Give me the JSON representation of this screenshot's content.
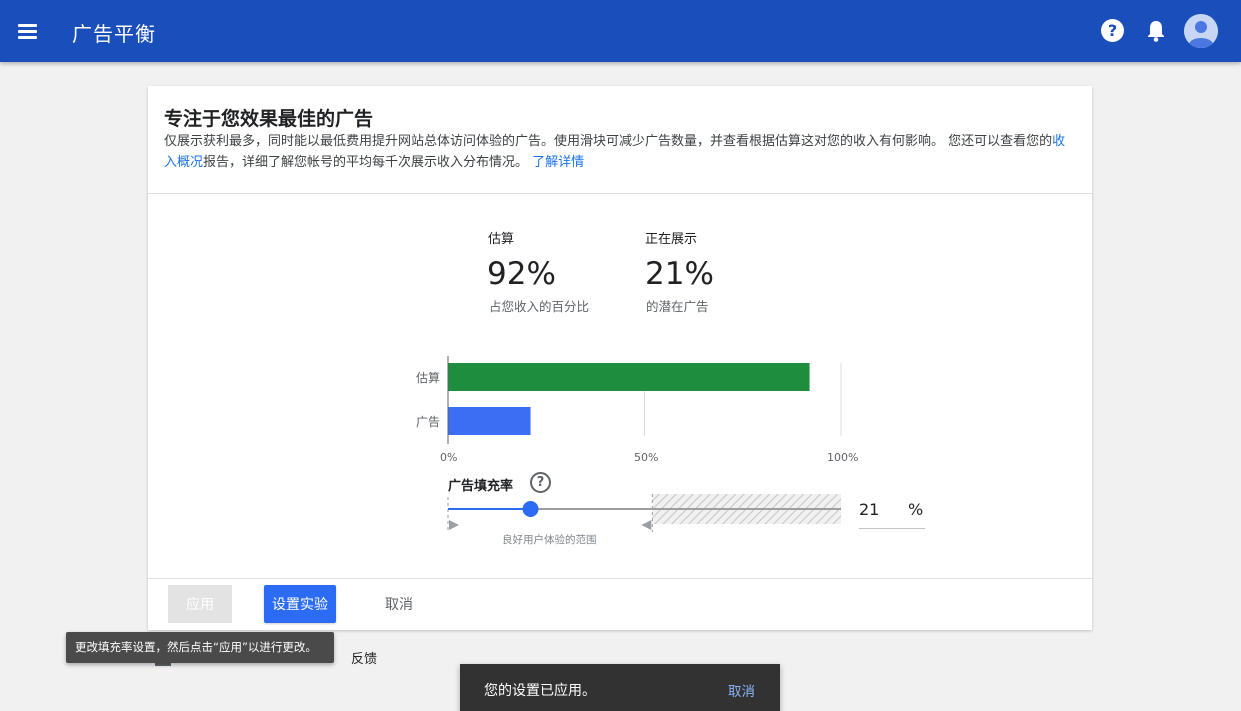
{
  "appbar": {
    "title": "广告平衡",
    "bg_color": "#1a4eba",
    "icons": [
      "menu-icon",
      "help-icon",
      "bell-icon",
      "avatar-icon"
    ]
  },
  "card": {
    "title": "专注于您效果最佳的广告",
    "desc_part1": "仅展示获利最多，同时能以最低费用提升网站总体访问体验的广告。使用滑块可减少广告数量，并查看根据估算这对您的收入有何影响。 您还可以查看您的",
    "desc_link1": "收入概况",
    "desc_part2": "报告，详细了解您帐号的平均每千次展示收入分布情况。",
    "desc_link2": "了解详情"
  },
  "stats": {
    "estimate": {
      "heading": "估算",
      "value": "92%",
      "sub": "占您收入的百分比"
    },
    "showing": {
      "heading": "正在展示",
      "value": "21%",
      "sub": "的潜在广告"
    }
  },
  "chart_data": {
    "type": "bar",
    "orientation": "horizontal",
    "categories": [
      "估算",
      "广告"
    ],
    "values": [
      92,
      21
    ],
    "colors": [
      "#1e8e3e",
      "#3b6ef2"
    ],
    "xlim": [
      0,
      100
    ],
    "xticks": [
      "0%",
      "50%",
      "100%"
    ]
  },
  "slider": {
    "title": "广告填充率",
    "value": 21,
    "min": 0,
    "max": 100,
    "good_range_max": 52,
    "value_text": "21",
    "unit": "%",
    "range_label": "良好用户体验的范围",
    "accent": "#2c6cf5"
  },
  "actions": {
    "apply_label": "应用",
    "experiment_label": "设置实验",
    "cancel_label": "取消"
  },
  "tooltip": {
    "text": "更改填充率设置，然后点击“应用”以进行更改。"
  },
  "feedback": {
    "text": "反馈"
  },
  "snackbar": {
    "message": "您的设置已应用。",
    "action": "取消"
  }
}
